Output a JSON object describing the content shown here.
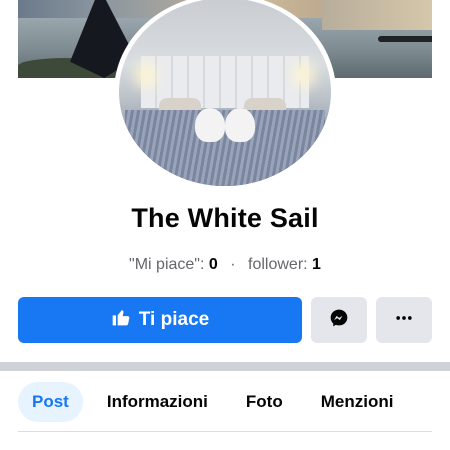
{
  "page": {
    "name": "The White Sail",
    "stats": {
      "likes_label": "\"Mi piace\":",
      "likes_count": "0",
      "separator": "·",
      "followers_label": "follower:",
      "followers_count": "1"
    }
  },
  "actions": {
    "like_label": "Ti piace",
    "messenger_icon": "messenger-icon",
    "more_icon": "more-icon"
  },
  "tabs": [
    {
      "label": "Post",
      "active": true
    },
    {
      "label": "Informazioni",
      "active": false
    },
    {
      "label": "Foto",
      "active": false
    },
    {
      "label": "Menzioni",
      "active": false
    }
  ],
  "colors": {
    "primary": "#1877f2",
    "button_gray": "#e4e6eb",
    "active_tab_bg": "#e7f3ff",
    "secondary_text": "#65676b"
  }
}
